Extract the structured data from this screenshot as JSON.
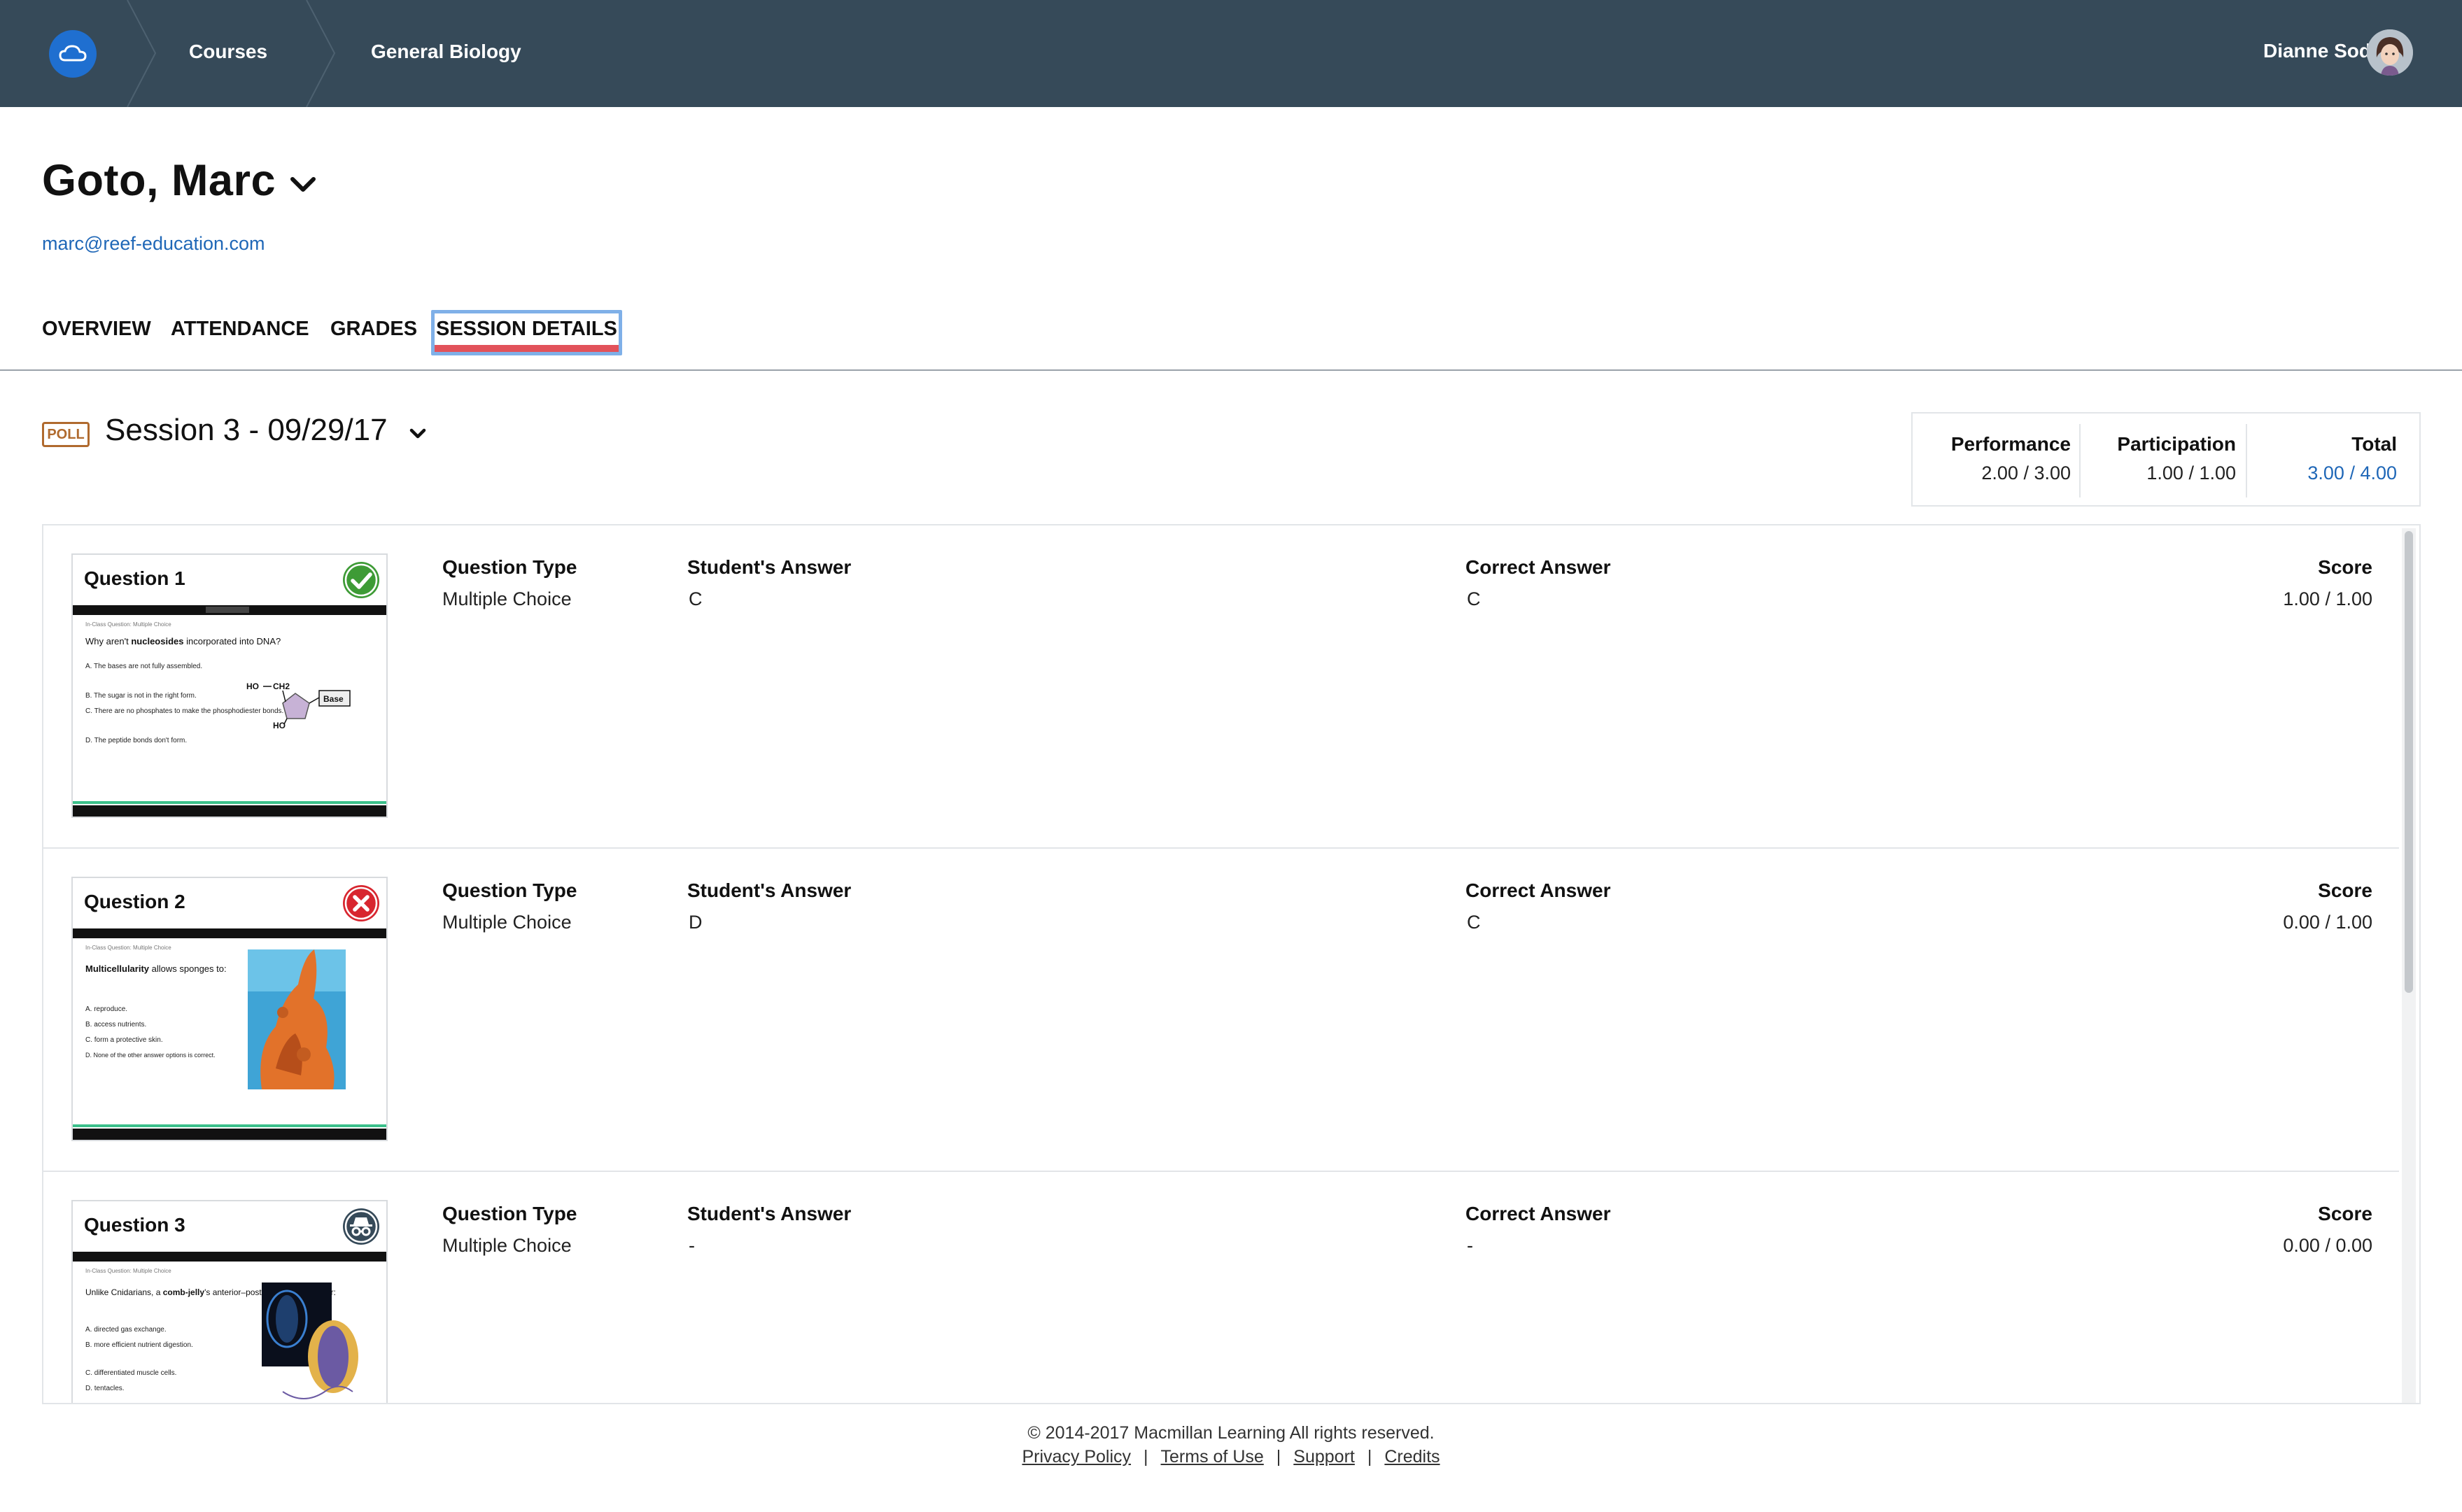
{
  "topbar": {
    "breadcrumbs": [
      "Courses",
      "General Biology"
    ],
    "user_name": "Dianne Sod",
    "colors": {
      "bg": "#364a59",
      "logo": "#1f6fd0"
    }
  },
  "student": {
    "name": "Goto, Marc",
    "email": "marc@reef-education.com"
  },
  "tabs": [
    {
      "label": "OVERVIEW",
      "active": false
    },
    {
      "label": "ATTENDANCE",
      "active": false
    },
    {
      "label": "GRADES",
      "active": false
    },
    {
      "label": "SESSION DETAILS",
      "active": true
    }
  ],
  "session": {
    "badge": "POLL",
    "title": "Session 3 - 09/29/17",
    "summary": {
      "performance_label": "Performance",
      "performance_value": "2.00 / 3.00",
      "participation_label": "Participation",
      "participation_value": "1.00 / 1.00",
      "total_label": "Total",
      "total_value": "3.00 / 4.00"
    }
  },
  "columns": {
    "type": "Question Type",
    "student_answer": "Student's Answer",
    "correct_answer": "Correct Answer",
    "score": "Score"
  },
  "questions": [
    {
      "title": "Question 1",
      "status": "correct",
      "status_icon": "check-circle-icon",
      "type": "Multiple Choice",
      "student_answer": "C",
      "correct_answer": "C",
      "score": "1.00 / 1.00",
      "slide": {
        "header": "In-Class Question: Multiple Choice",
        "q_pre": "Why aren't ",
        "q_bold": "nucleosides",
        "q_post": " incorporated into DNA?",
        "options": [
          "A.  The bases are not fully assembled.",
          "B.  The sugar is not in the right form.",
          "C.  There are no phosphates to make the phosphodiester bonds.",
          "D.  The peptide bonds don't form."
        ],
        "figure_labels": [
          "HO",
          "CH2",
          "Base",
          "HO"
        ]
      }
    },
    {
      "title": "Question 2",
      "status": "incorrect",
      "status_icon": "x-circle-icon",
      "type": "Multiple Choice",
      "student_answer": "D",
      "correct_answer": "C",
      "score": "0.00 / 1.00",
      "slide": {
        "header": "In-Class Question: Multiple Choice",
        "q_bold": "Multicellularity",
        "q_post": " allows sponges to:",
        "options": [
          "A.  reproduce.",
          "B.  access nutrients.",
          "C.  form a protective skin.",
          "D.  None of the other answer options is correct."
        ]
      }
    },
    {
      "title": "Question 3",
      "status": "absent",
      "status_icon": "incognito-icon",
      "type": "Multiple Choice",
      "student_answer": "-",
      "correct_answer": "-",
      "score": "0.00 / 0.00",
      "slide": {
        "header": "In-Class Question: Multiple Choice",
        "q_pre": "Unlike Cnidarians, a ",
        "q_bold": "comb-jelly",
        "q_post": "'s anterior–posterior axis allows for:",
        "options": [
          "A.  directed gas exchange.",
          "B.  more efficient nutrient digestion.",
          "C.  differentiated muscle cells.",
          "D.  tentacles."
        ]
      }
    }
  ],
  "footer": {
    "copyright": "© 2014-2017 Macmillan Learning All rights reserved.",
    "links": [
      "Privacy Policy",
      "Terms of Use",
      "Support",
      "Credits"
    ],
    "separator": "|"
  },
  "accent_colors": {
    "link_blue": "#1f67b7",
    "tab_underline": "#e2525a",
    "poll_badge": "#b06a2e",
    "correct": "#3e9b36",
    "incorrect": "#d8262f",
    "absent": "#364a59"
  }
}
